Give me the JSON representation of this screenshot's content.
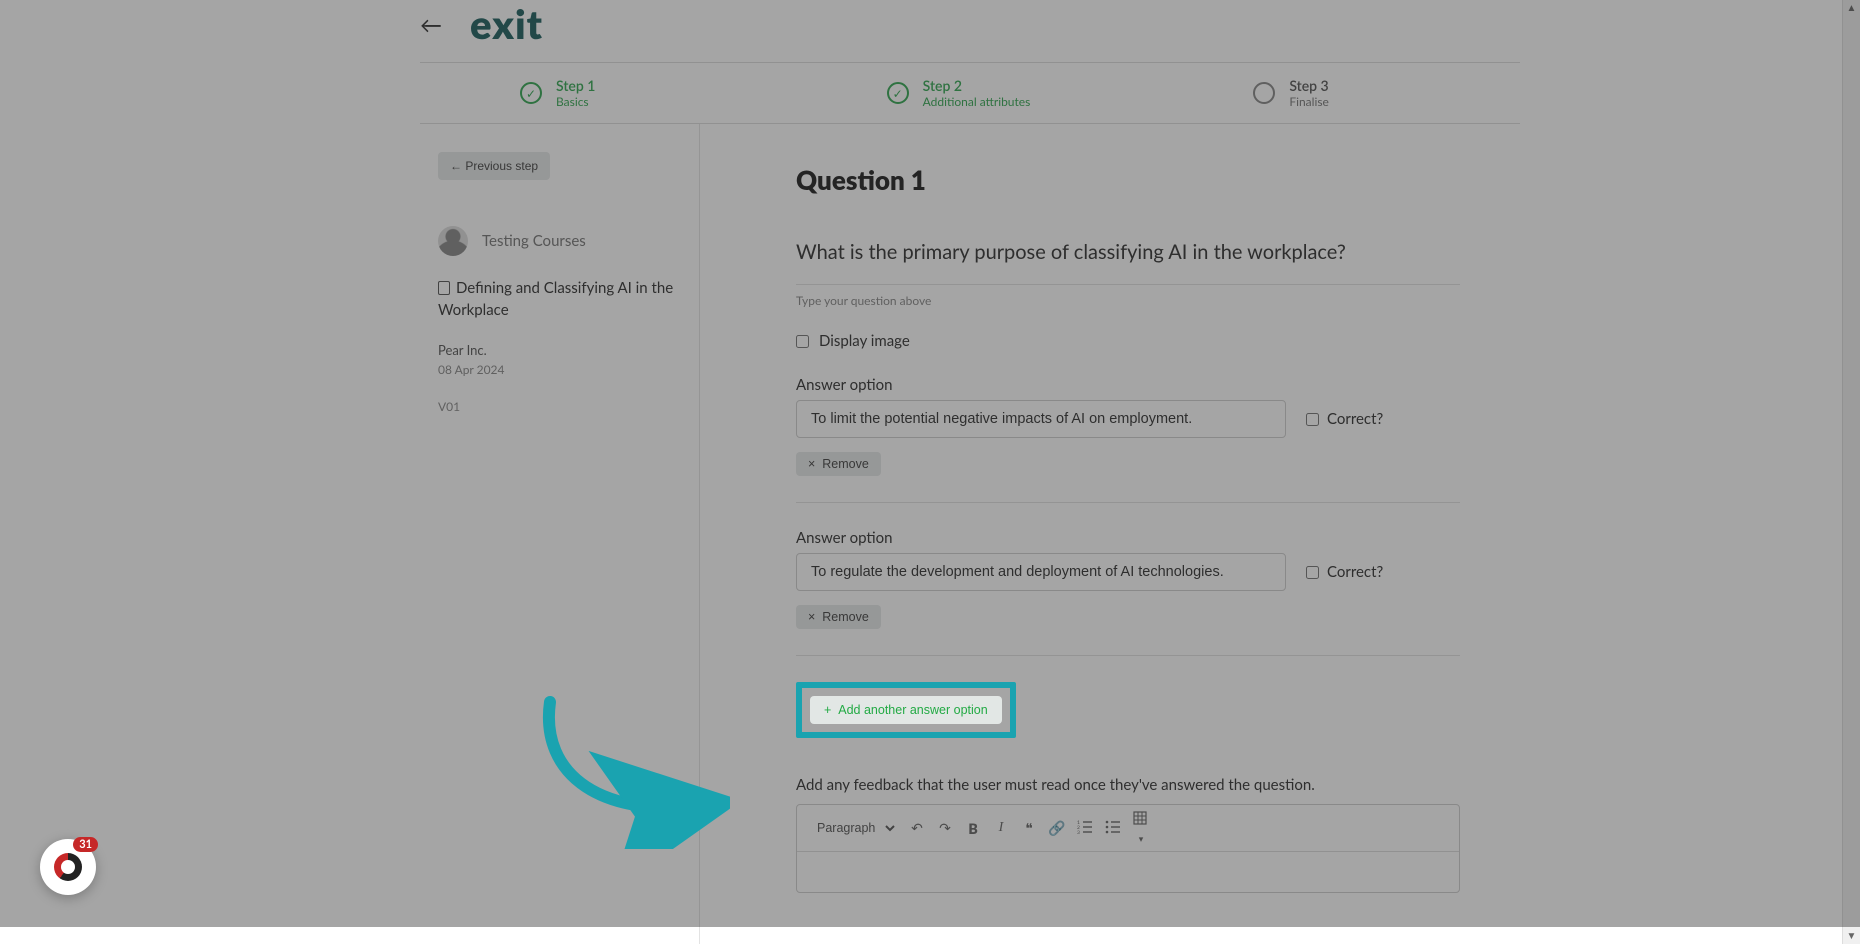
{
  "brand": "exit",
  "steps": [
    {
      "title": "Step 1",
      "sub": "Basics",
      "state": "done"
    },
    {
      "title": "Step 2",
      "sub": "Additional attributes",
      "state": "done"
    },
    {
      "title": "Step 3",
      "sub": "Finalise",
      "state": "pending"
    }
  ],
  "sidebar": {
    "prev_label": "←  Previous step",
    "user": "Testing Courses",
    "doc_title": "Defining and Classifying AI in the Workplace",
    "org": "Pear Inc.",
    "date": "08 Apr 2024",
    "version": "V01"
  },
  "question": {
    "heading": "Question 1",
    "text": "What is the primary purpose of classifying AI in the workplace?",
    "hint": "Type your question above",
    "display_image_label": "Display image",
    "answer_label": "Answer option",
    "correct_label": "Correct?",
    "remove_label": "Remove",
    "answers": [
      {
        "value": "To limit the potential negative impacts of AI on employment."
      },
      {
        "value": "To regulate the development and deployment of AI technologies."
      }
    ],
    "add_label": "Add another answer option",
    "feedback_label": "Add any feedback that the user must read once they've answered the question."
  },
  "editor": {
    "style_options": [
      "Paragraph"
    ],
    "style_selected": "Paragraph"
  },
  "help_badge": "31"
}
